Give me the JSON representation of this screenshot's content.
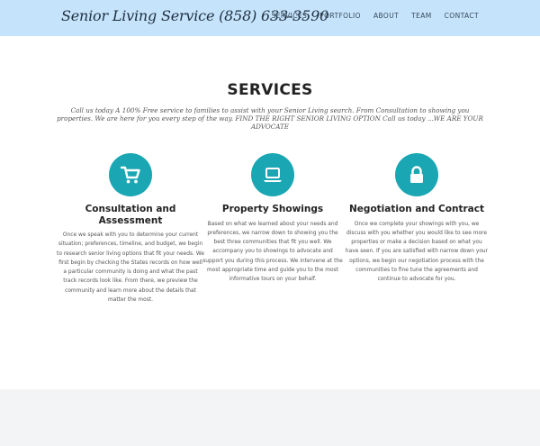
{
  "header": {
    "brand": "Senior Living Service (858) 633-3590",
    "nav": [
      "SERVICES",
      "PORTFOLIO",
      "ABOUT",
      "TEAM",
      "CONTACT"
    ]
  },
  "services": {
    "title": "SERVICES",
    "intro": "Call us today A 100% Free service to families to assist with your Senior Living search. From Consultation to showing you properties. We are here for you every step of the way. FIND THE RIGHT SENIOR LIVING OPTION Call us today ...WE ARE YOUR ADVOCATE",
    "items": [
      {
        "icon": "shopping-cart-icon",
        "title": "Consultation and Assessment",
        "body": "Once we speak with you to determine your current situation; preferences, timeline, and budget, we begin to research senior living options that fit your needs. We first begin by checking the States records on how well a particular community is doing and what the past track records look like. From there, we preview the community and learn more about the details that matter the most."
      },
      {
        "icon": "laptop-icon",
        "title": "Property Showings",
        "body": "Based on what we learned about your needs and preferences, we narrow down to showing you the best three communities that fit you well. We accompany you to showings to advocate and support you during this process. We intervene at the most appropriate time and guide you to the most informative tours on your behalf."
      },
      {
        "icon": "lock-icon",
        "title": "Negotiation and Contract",
        "body": "Once we complete your showings with you, we discuss with you whether you would like to see more properties or make a decision based on what you have seen. If you are satisfied with narrow down your options, we begin our negotiation process with the communities to fine tune the agreements and continue to advocate for you."
      }
    ]
  },
  "colors": {
    "navbar_bg": "#c5e3fb",
    "accent": "#1aa6b3"
  }
}
